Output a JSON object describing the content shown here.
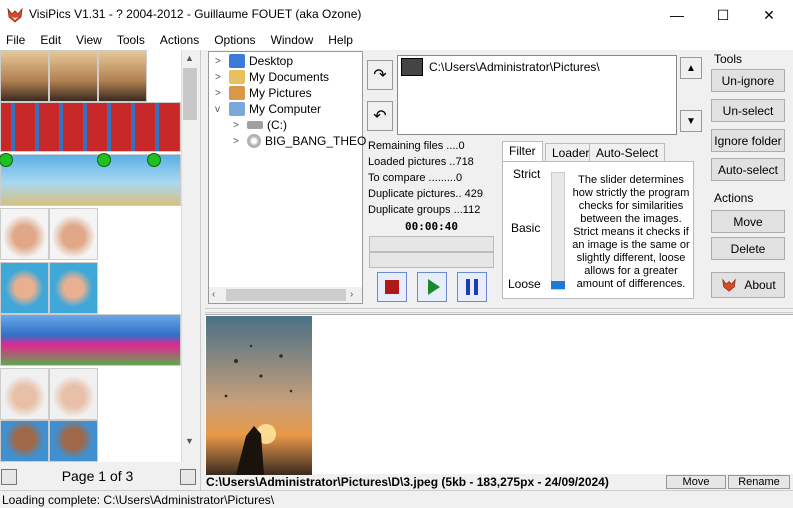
{
  "window": {
    "title": "VisiPics V1.31 - ? 2004-2012 - Guillaume FOUET (aka Ozone)",
    "min_glyph": "—",
    "max_glyph": "☐",
    "close_glyph": "✕"
  },
  "menu": [
    "File",
    "Edit",
    "View",
    "Tools",
    "Actions",
    "Options",
    "Window",
    "Help"
  ],
  "thumbnails": {
    "page_label": "Page 1 of 3"
  },
  "tree": {
    "items": [
      {
        "label": "Desktop",
        "chevron": ">"
      },
      {
        "label": "My Documents",
        "chevron": ">"
      },
      {
        "label": "My Pictures",
        "chevron": ">"
      },
      {
        "label": "My Computer",
        "chevron": "v"
      },
      {
        "label": "(C:)",
        "chevron": ">"
      },
      {
        "label": "BIG_BANG_THEO",
        "chevron": ">"
      }
    ]
  },
  "path": {
    "current": "C:\\Users\\Administrator\\Pictures\\"
  },
  "stats": {
    "remaining": "Remaining files ....0",
    "loaded": "Loaded pictures ..718",
    "to_compare": "To compare .........0",
    "duplicates": "Duplicate pictures.. 429",
    "groups": "Duplicate groups ...112",
    "timer": "00:00:40"
  },
  "tabs": {
    "filter": "Filter",
    "loader": "Loader",
    "auto": "Auto-Select"
  },
  "slider": {
    "strict": "Strict",
    "basic": "Basic",
    "loose": "Loose",
    "description": "The slider determines how strictly the program checks for similarities between the images. Strict means it checks if an image is the same or slightly different, loose allows for a greater amount of differences."
  },
  "tools": {
    "label": "Tools",
    "unignore": "Un-ignore",
    "unselect": "Un-select",
    "ignore_folder": "Ignore folder",
    "auto_select": "Auto-select"
  },
  "actions": {
    "label": "Actions",
    "move": "Move",
    "delete": "Delete",
    "about": "About"
  },
  "preview": {
    "info": "C:\\Users\\Administrator\\Pictures\\D\\3.jpeg (5kb - 183,275px - 24/09/2024)",
    "move": "Move",
    "rename": "Rename"
  },
  "status": {
    "text": "Loading complete: C:\\Users\\Administrator\\Pictures\\"
  },
  "colors": {
    "stop": "#b01818",
    "play": "#1a8a2a",
    "pause": "#1a3fb0",
    "slider": "#1e7ad6"
  }
}
